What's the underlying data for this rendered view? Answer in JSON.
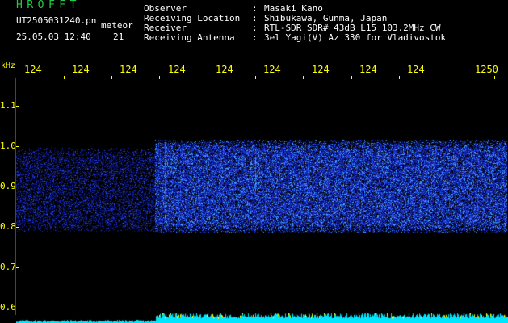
{
  "header": {
    "app_title": "HROFFT",
    "file_name": "UT2505031240.pn",
    "mode": "meteor",
    "date_time": "25.05.03 12:40",
    "count": "21"
  },
  "station_info": [
    {
      "label": "Observer",
      "value": "Masaki Kano"
    },
    {
      "label": "Receiving Location",
      "value": "Shibukawa, Gunma, Japan"
    },
    {
      "label": "Receiver",
      "value": "RTL-SDR SDR# 43dB L15 103.2MHz CW"
    },
    {
      "label": "Receiving Antenna",
      "value": "3el Yagi(V) Az 330 for Vladivostok"
    }
  ],
  "spectrogram": {
    "y_unit": "kHz",
    "x_ticks": [
      "124",
      "124",
      "124",
      "124",
      "124",
      "124",
      "124",
      "124",
      "124",
      "1250"
    ],
    "y_ticks": [
      "1.1",
      "1.0",
      "0.9",
      "0.8",
      "0.7",
      "0.6"
    ],
    "colors": {
      "axis_text": "#ffff00",
      "signal": "#1f3cff",
      "signal_bright": "#66ccff",
      "level_trace": "#00e6ff",
      "background": "#000000"
    }
  }
}
